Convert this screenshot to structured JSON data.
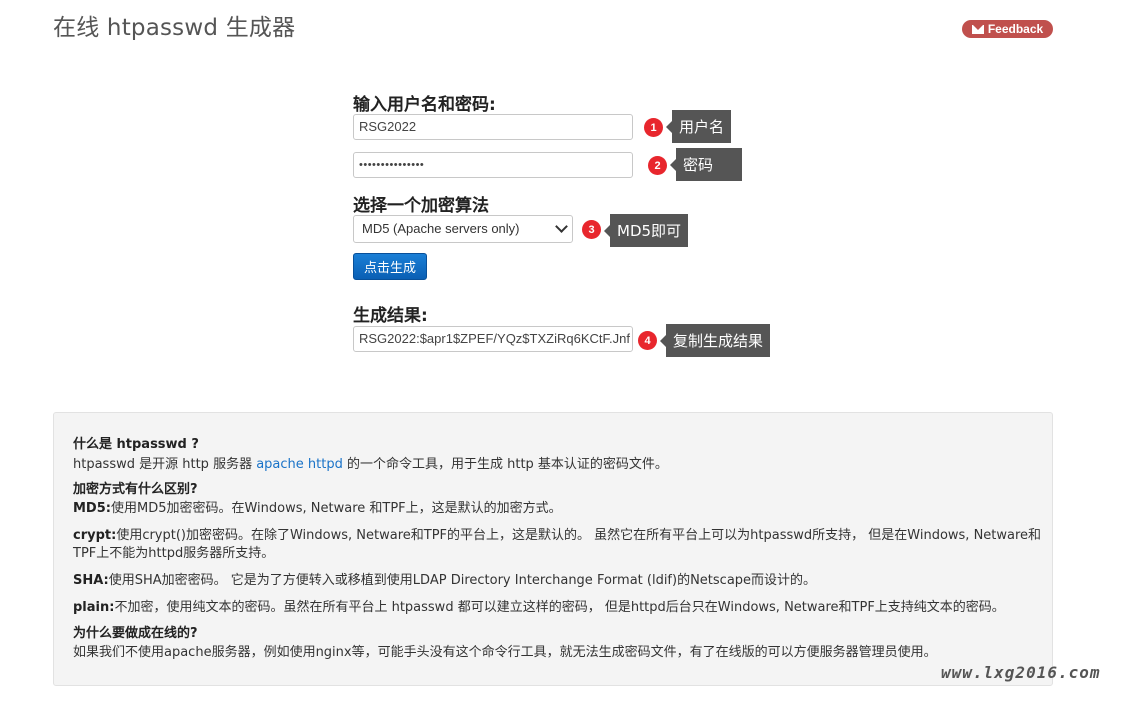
{
  "page": {
    "title": "在线 htpasswd 生成器",
    "feedback_label": "Feedback"
  },
  "form": {
    "credentials_heading": "输入用户名和密码:",
    "username_value": "RSG2022",
    "password_value": "•••••••••••••••",
    "algorithm_heading": "选择一个加密算法",
    "algorithm_selected": "MD5 (Apache servers only)",
    "generate_button": "点击生成",
    "result_heading": "生成结果:",
    "result_value": "RSG2022:$apr1$ZPEF/YQz$TXZiRq6KCtF.Jnf"
  },
  "annotations": [
    {
      "number": "1",
      "text": "用户名"
    },
    {
      "number": "2",
      "text": "密码"
    },
    {
      "number": "3",
      "text": "MD5即可"
    },
    {
      "number": "4",
      "text": "复制生成结果"
    }
  ],
  "info": {
    "q1": "什么是 htpasswd ?",
    "q1_text_before": "htpasswd 是开源 http 服务器 ",
    "q1_link": "apache httpd",
    "q1_text_after": " 的一个命令工具，用于生成 http 基本认证的密码文件。",
    "q2": "加密方式有什么区别?",
    "md5_term": "MD5:",
    "md5_text": "使用MD5加密密码。在Windows, Netware 和TPF上，这是默认的加密方式。",
    "crypt_term": "crypt:",
    "crypt_text_1": "使用crypt()加密密码。在除了Windows, Netware和TPF的平台上，这是默认的。 虽然它在所有平台上可以为htpasswd所支持， 但是在Windows, Netware和",
    "crypt_text_2": "TPF上不能为httpd服务器所支持。",
    "sha_term": "SHA:",
    "sha_text": "使用SHA加密密码。 它是为了方便转入或移植到使用LDAP Directory Interchange Format (ldif)的Netscape而设计的。",
    "plain_term": "plain:",
    "plain_text": "不加密，使用纯文本的密码。虽然在所有平台上 htpasswd 都可以建立这样的密码， 但是httpd后台只在Windows, Netware和TPF上支持纯文本的密码。",
    "q3": "为什么要做成在线的?",
    "q3_text": "如果我们不使用apache服务器，例如使用nginx等，可能手头没有这个命令行工具，就无法生成密码文件，有了在线版的可以方便服务器管理员使用。"
  },
  "watermark": "www.lxg2016.com"
}
